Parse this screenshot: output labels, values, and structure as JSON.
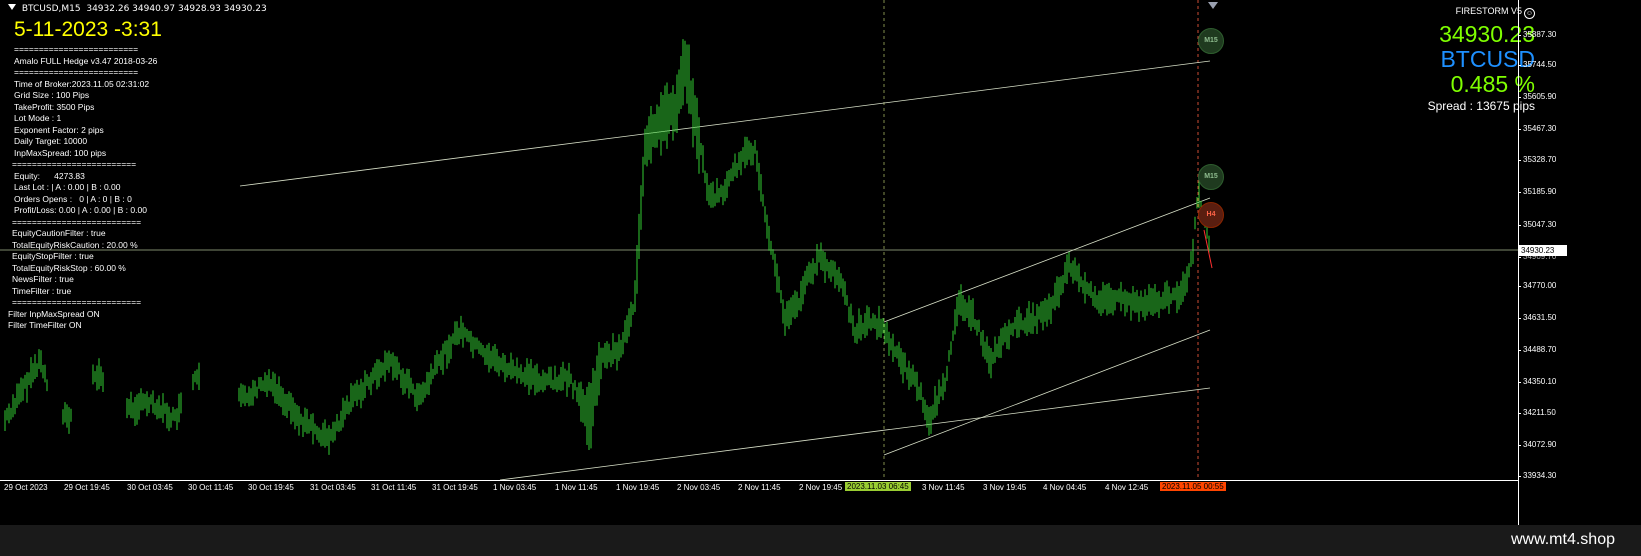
{
  "header": {
    "symbol_period": "BTCUSD,M15",
    "ohlc": "34932.26 34940.97 34928.93 34930.23"
  },
  "clock": "5-11-2023 -3:31",
  "info_panel": {
    "lines": [
      {
        "text": "=========================",
        "cls": "ind1"
      },
      {
        "text": "Amalo FULL Hedge v3.47 2018-03-26",
        "cls": "ind1"
      },
      {
        "text": "=========================",
        "cls": "ind1"
      },
      {
        "text": "Time of Broker:2023.11.05 02:31:02",
        "cls": "ind1"
      },
      {
        "text": "Grid Size : 100 Pips",
        "cls": "ind1"
      },
      {
        "text": "TakeProfit: 3500 Pips",
        "cls": "ind1"
      },
      {
        "text": "Lot Mode : 1",
        "cls": "ind1"
      },
      {
        "text": "Exponent Factor: 2 pips",
        "cls": "ind1"
      },
      {
        "text": "Daily Target: 10000",
        "cls": "ind1"
      },
      {
        "text": "InpMaxSpread: 100 pips",
        "cls": "ind1"
      },
      {
        "text": "=========================",
        "cls": "ind2"
      },
      {
        "text": "Equity:      4273.83",
        "cls": "ind1"
      },
      {
        "text": "Last Lot : | A : 0.00 | B : 0.00",
        "cls": "ind1"
      },
      {
        "text": "Orders Opens :   0 | A : 0 | B : 0",
        "cls": "ind1"
      },
      {
        "text": "Profit/Loss: 0.00 | A : 0.00 | B : 0.00",
        "cls": "ind1"
      },
      {
        "text": "==========================",
        "cls": "ind2"
      },
      {
        "text": "EquityCautionFilter : true",
        "cls": "ind2"
      },
      {
        "text": "TotalEquityRiskCaution : 20.00 %",
        "cls": "ind2"
      },
      {
        "text": "EquityStopFilter : true",
        "cls": "ind2"
      },
      {
        "text": "TotalEquityRiskStop : 60.00 %",
        "cls": "ind2"
      },
      {
        "text": "NewsFilter : true",
        "cls": "ind2"
      },
      {
        "text": "TimeFilter : true",
        "cls": "ind2"
      },
      {
        "text": "==========================",
        "cls": "ind2"
      },
      {
        "text": "Filter InpMaxSpread ON",
        "cls": ""
      },
      {
        "text": "Filter TimeFilter ON",
        "cls": ""
      }
    ]
  },
  "right_panel": {
    "title": "FIRESTORM V5",
    "price": "34930.23",
    "symbol": "BTCUSD",
    "percent": "0.485 %",
    "spread": "Spread : 13675 pips"
  },
  "y_axis": {
    "ticks": [
      "35887.30",
      "35744.50",
      "35605.90",
      "35467.30",
      "35328.70",
      "35185.90",
      "35047.30",
      "34770.00",
      "34631.50",
      "34488.70",
      "34350.10",
      "34211.50",
      "34072.90",
      "33934.30"
    ],
    "overlap_label": "34909.70",
    "current_price": "34930.23"
  },
  "x_axis": {
    "ticks": [
      "29 Oct 2023",
      "29 Oct 19:45",
      "30 Oct 03:45",
      "30 Oct 11:45",
      "30 Oct 19:45",
      "31 Oct 03:45",
      "31 Oct 11:45",
      "31 Oct 19:45",
      "1 Nov 03:45",
      "1 Nov 11:45",
      "1 Nov 19:45",
      "2 Nov 03:45",
      "2 Nov 11:45",
      "2 Nov 19:45",
      "3 Nov 11:45",
      "3 Nov 19:45",
      "4 Nov 04:45",
      "4 Nov 12:45"
    ],
    "highlight_green": "2023.11.03 06:45",
    "highlight_orange": "2023.11.05 00:55"
  },
  "badges": {
    "m15_a": "M15",
    "m15_b": "M15",
    "h4": "H4"
  },
  "colors": {
    "candle": "#32cd32",
    "trendline": "#d8e0c8",
    "vline_green": "#a0b060",
    "vline_red": "#ff6040",
    "price_big": "#7fff00",
    "symbol_big": "#1e90ff"
  },
  "watermark": "www.mt4.shop"
}
